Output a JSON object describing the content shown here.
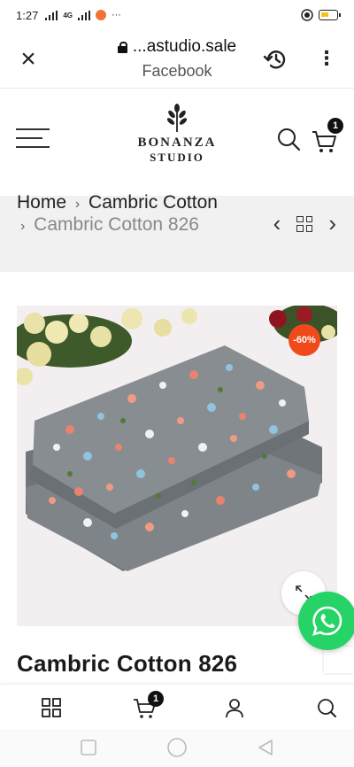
{
  "status_bar": {
    "time": "1:27",
    "network_label": "4G",
    "more": "···"
  },
  "browser": {
    "url": "...astudio.sale",
    "site_name": "Facebook",
    "close_icon": "close-icon",
    "history_icon": "history-icon",
    "menu_icon": "more-vert-icon"
  },
  "header": {
    "logo_line1": "BONANZA",
    "logo_line2": "STUDIO",
    "cart_count": "1"
  },
  "breadcrumb": {
    "home": "Home",
    "category": "Cambric Cotton",
    "current": "Cambric Cotton 826",
    "separator": "›",
    "prev": "‹",
    "next": "›"
  },
  "product": {
    "discount_badge": "-60%",
    "title": "Cambric Cotton 826"
  },
  "bottom_nav": {
    "cart_count": "1"
  },
  "colors": {
    "accent": "#f04a1a",
    "whatsapp": "#25d366",
    "fabric": "#7f8589"
  }
}
